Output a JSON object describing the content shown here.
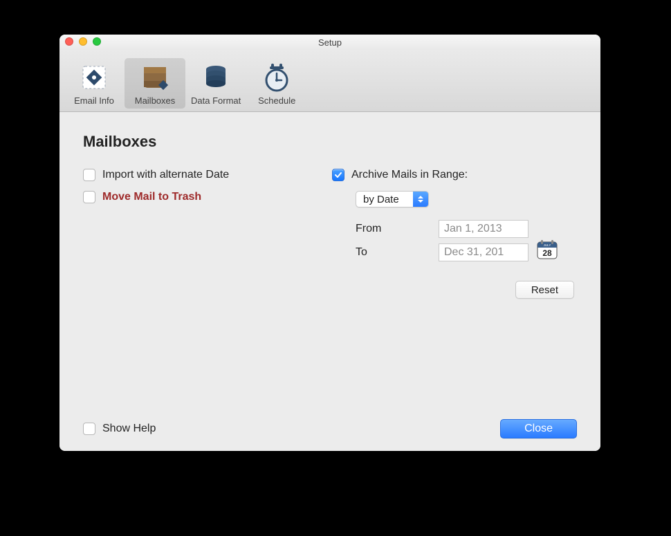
{
  "window": {
    "title": "Setup"
  },
  "toolbar": {
    "items": [
      {
        "label": "Email Info"
      },
      {
        "label": "Mailboxes"
      },
      {
        "label": "Data Format"
      },
      {
        "label": "Schedule"
      }
    ],
    "selected_index": 1
  },
  "page": {
    "title": "Mailboxes"
  },
  "left": {
    "import_alt_date": {
      "label": "Import with alternate Date",
      "checked": false
    },
    "move_to_trash": {
      "label": "Move Mail to Trash",
      "checked": false
    }
  },
  "right": {
    "archive_range": {
      "label": "Archive Mails in Range:",
      "checked": true
    },
    "range_select": {
      "value": "by Date"
    },
    "from": {
      "label": "From",
      "value": "Jan 1, 2013"
    },
    "to": {
      "label": "To",
      "value": "Dec 31, 201"
    },
    "calendar_badge": {
      "month": "JULY",
      "day": "28"
    },
    "reset": {
      "label": "Reset"
    }
  },
  "footer": {
    "show_help": {
      "label": "Show Help",
      "checked": false
    },
    "close": {
      "label": "Close"
    }
  }
}
